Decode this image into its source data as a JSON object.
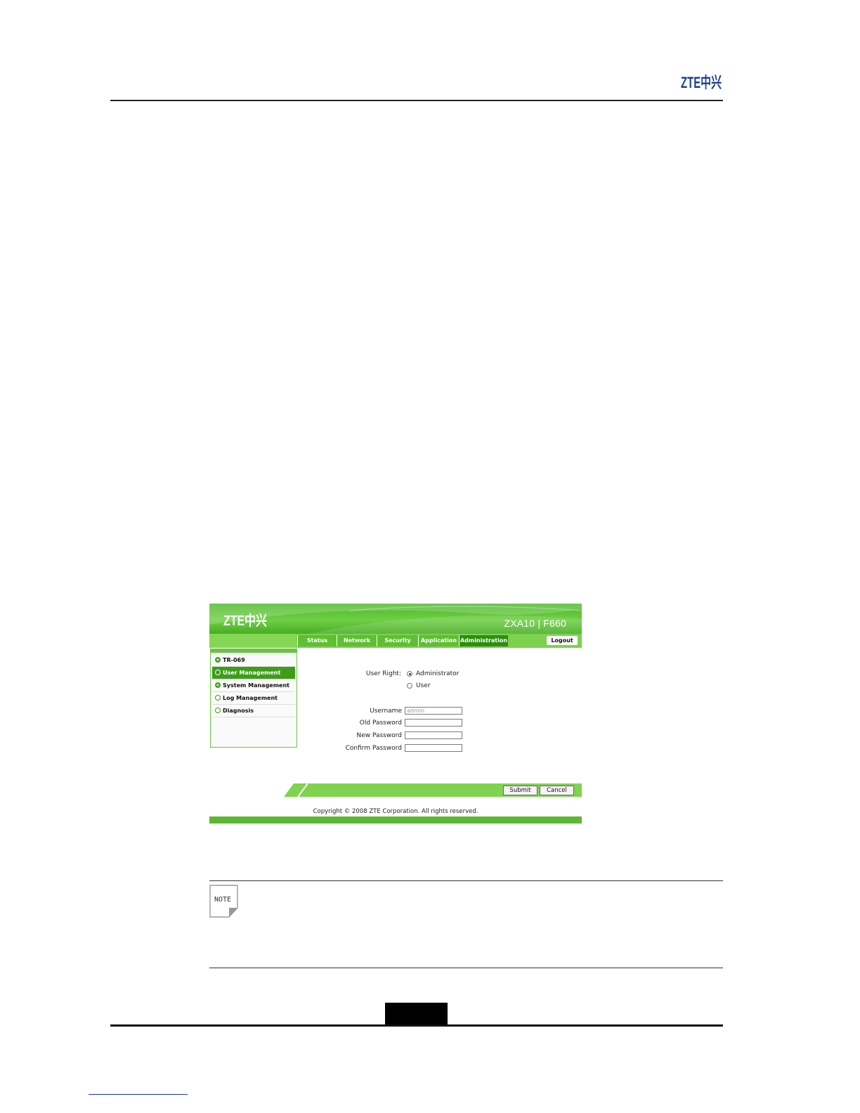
{
  "header": {
    "logo_text": "ZTE中兴"
  },
  "screenshot": {
    "banner": {
      "logo_text": "ZTE中兴",
      "product": "ZXA10 | F660"
    },
    "tabs": [
      {
        "label": "Status",
        "active": false
      },
      {
        "label": "Network",
        "active": false
      },
      {
        "label": "Security",
        "active": false
      },
      {
        "label": "Application",
        "active": false
      },
      {
        "label": "Administration",
        "active": true
      }
    ],
    "logout_label": "Logout",
    "sidebar": [
      {
        "label": "TR-069",
        "icon": "plus-circle-icon",
        "active": false
      },
      {
        "label": "User Management",
        "icon": "circle-icon",
        "active": true
      },
      {
        "label": "System Management",
        "icon": "plus-circle-icon",
        "active": false
      },
      {
        "label": "Log Management",
        "icon": "circle-icon",
        "active": false
      },
      {
        "label": "Diagnosis",
        "icon": "circle-icon",
        "active": false
      }
    ],
    "form": {
      "user_right_label": "User Right:",
      "options": [
        {
          "label": "Administrator",
          "checked": true
        },
        {
          "label": "User",
          "checked": false
        }
      ],
      "username_label": "Username",
      "username_value": "admin",
      "old_password_label": "Old Password",
      "new_password_label": "New Password",
      "confirm_password_label": "Confirm Password"
    },
    "buttons": {
      "submit": "Submit",
      "cancel": "Cancel"
    },
    "copyright": "Copyright © 2008 ZTE Corporation. All rights reserved."
  },
  "note": {
    "icon_label": "NOTE"
  },
  "colors": {
    "brand_green": "#4cb82a",
    "active_tab": "#2e8e10",
    "zte_blue": "#1b3f8f"
  }
}
